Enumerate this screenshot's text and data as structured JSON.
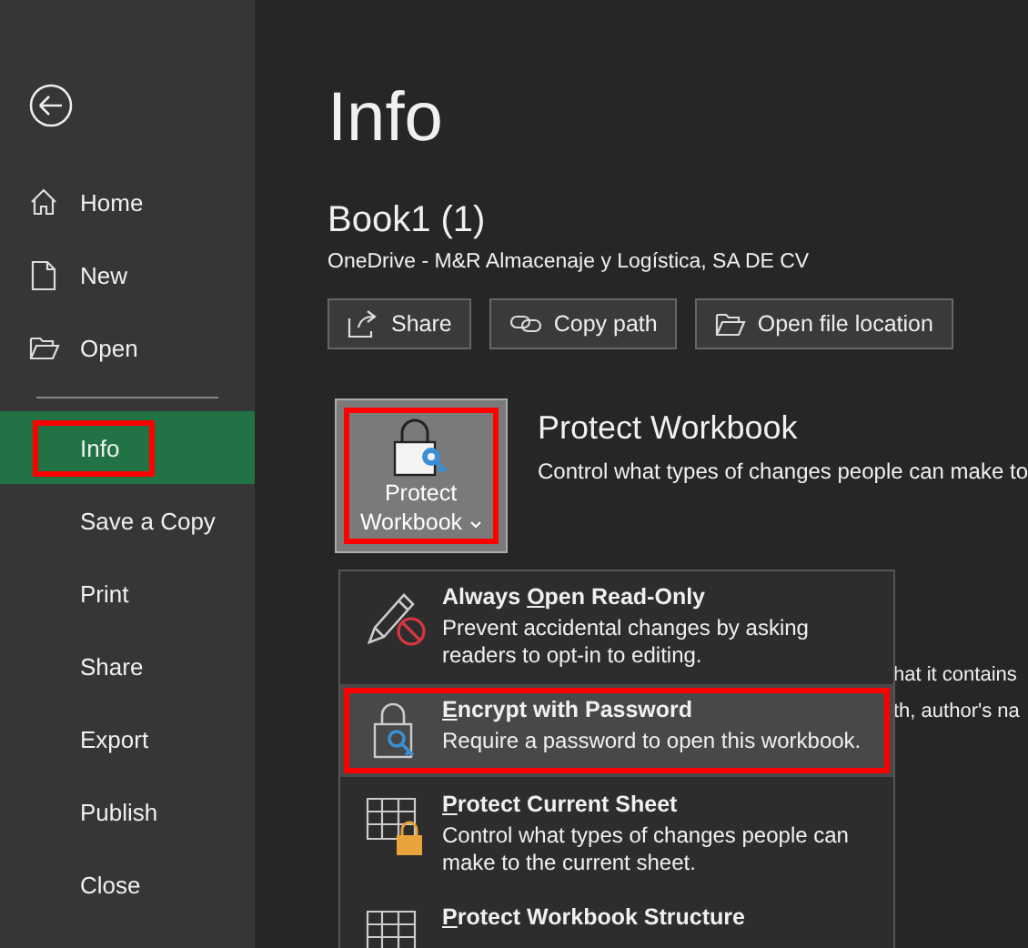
{
  "sidebar": {
    "items": [
      {
        "label": "Home",
        "selected": false,
        "annotated": false
      },
      {
        "label": "New",
        "selected": false,
        "annotated": false
      },
      {
        "label": "Open",
        "selected": false,
        "annotated": false
      },
      {
        "kind": "divider"
      },
      {
        "label": "Info",
        "selected": true,
        "annotated": true
      },
      {
        "label": "Save a Copy",
        "selected": false,
        "annotated": false
      },
      {
        "label": "Print",
        "selected": false,
        "annotated": false
      },
      {
        "label": "Share",
        "selected": false,
        "annotated": false
      },
      {
        "label": "Export",
        "selected": false,
        "annotated": false
      },
      {
        "label": "Publish",
        "selected": false,
        "annotated": false
      },
      {
        "label": "Close",
        "selected": false,
        "annotated": false
      }
    ]
  },
  "page_title": "Info",
  "document": {
    "name": "Book1 (1)",
    "location": "OneDrive - M&R Almacenaje y Logística, SA DE CV"
  },
  "actions": [
    {
      "label": "Share"
    },
    {
      "label": "Copy path"
    },
    {
      "label": "Open file location"
    }
  ],
  "protect": {
    "button_lines": [
      "Protect",
      "Workbook"
    ],
    "annotated": true,
    "title": "Protect Workbook",
    "description": "Control what types of changes people can make to"
  },
  "background_text": [
    "hat it contains",
    "th, author's na"
  ],
  "protect_menu": [
    {
      "title_before": "Always ",
      "access_key": "O",
      "title_after": "pen Read-Only",
      "description": "Prevent accidental changes by asking readers to opt-in to editing.",
      "selected": false,
      "annotated": false
    },
    {
      "access_key": "E",
      "title_after": "ncrypt with Password",
      "description": "Require a password to open this workbook.",
      "selected": true,
      "annotated": true
    },
    {
      "access_key": "P",
      "title_after": "rotect Current Sheet",
      "description": "Control what types of changes people can make to the current sheet.",
      "selected": false,
      "annotated": false
    },
    {
      "access_key": "P",
      "title_after": "rotect Workbook Structure",
      "selected": false,
      "annotated": false
    }
  ]
}
